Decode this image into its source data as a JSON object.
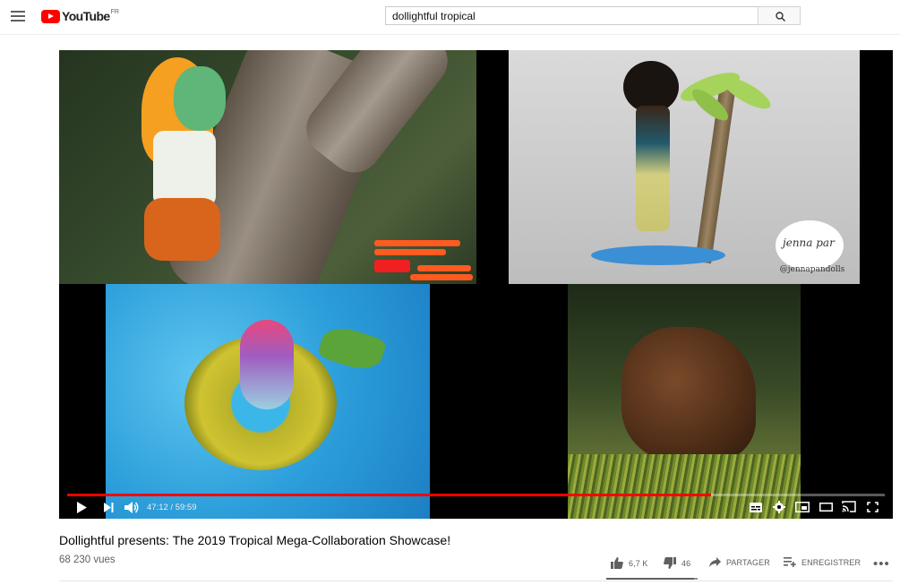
{
  "header": {
    "logo_text": "YouTube",
    "logo_region": "FR",
    "search_value": "dollightful tropical",
    "icons": [
      "menu-icon",
      "youtube-logo-icon",
      "search-icon"
    ]
  },
  "player": {
    "time_current": "47:12",
    "time_separator": " / ",
    "time_total": "59:59",
    "progress_fraction": 0.787,
    "overlays": {
      "jenna_logo": "jenna par",
      "jenna_handle": "@jennapandolls"
    },
    "controls": [
      "play-icon",
      "next-icon",
      "volume-icon",
      "subtitles-icon",
      "settings-icon",
      "miniplayer-icon",
      "theater-icon",
      "cast-icon",
      "fullscreen-icon"
    ]
  },
  "video": {
    "title": "Dollightful presents: The 2019 Tropical Mega-Collaboration Showcase!",
    "views": "68 230 vues",
    "likes": "6,7 K",
    "dislikes": "46",
    "share_label": "PARTAGER",
    "save_label": "ENREGISTRER",
    "more_label": "•••"
  },
  "colors": {
    "accent": "#ff0000",
    "text_primary": "#030303",
    "text_secondary": "#606060"
  }
}
